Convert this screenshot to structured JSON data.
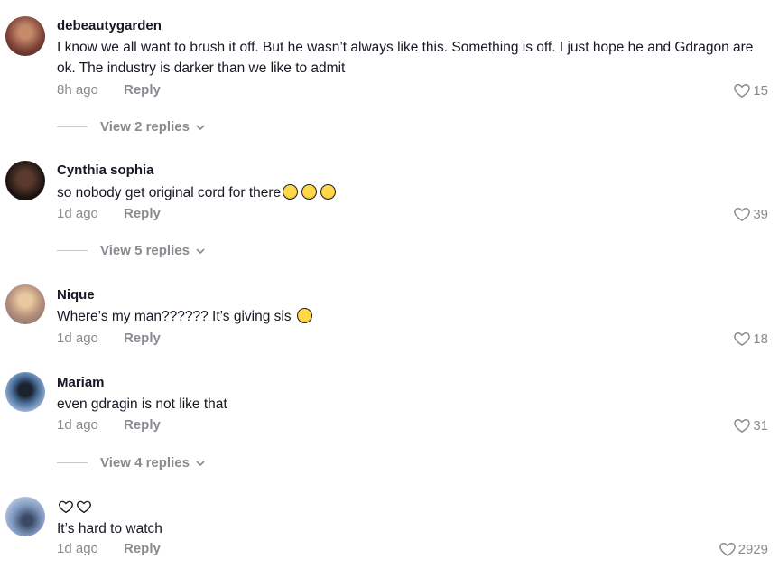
{
  "comments": [
    {
      "username": "debeautygarden",
      "text": "I know we all want to brush it off. But he wasn’t always like this. Something is off. I just hope he and Gdragon are ok. The industry is darker than we like to admit",
      "time": "8h ago",
      "reply_label": "Reply",
      "likes": "15",
      "view_replies": "View 2 replies"
    },
    {
      "username": "Cynthia sophia",
      "text": "so nobody get original cord for there",
      "emojis": [
        "tired-face-emoji",
        "tired-face-emoji",
        "laughing-tears-emoji"
      ],
      "time": "1d ago",
      "reply_label": "Reply",
      "likes": "39",
      "view_replies": "View 5 replies"
    },
    {
      "username": "Nique",
      "text": "Where’s my man?????? It’s giving sis",
      "emojis": [
        "rolling-eyes-emoji"
      ],
      "time": "1d ago",
      "reply_label": "Reply",
      "likes": "18"
    },
    {
      "username": "Mariam",
      "text": "even gdragin is not like that",
      "time": "1d ago",
      "reply_label": "Reply",
      "likes": "31",
      "view_replies": "View 4 replies"
    },
    {
      "username_icons": [
        "heart-outline-icon",
        "heart-outline-icon"
      ],
      "text": "It’s hard to watch",
      "time": "1d ago",
      "reply_label": "Reply",
      "likes": "2929"
    }
  ],
  "colors": {
    "primary_text": "#161823",
    "secondary_text": "#8a8b91"
  }
}
